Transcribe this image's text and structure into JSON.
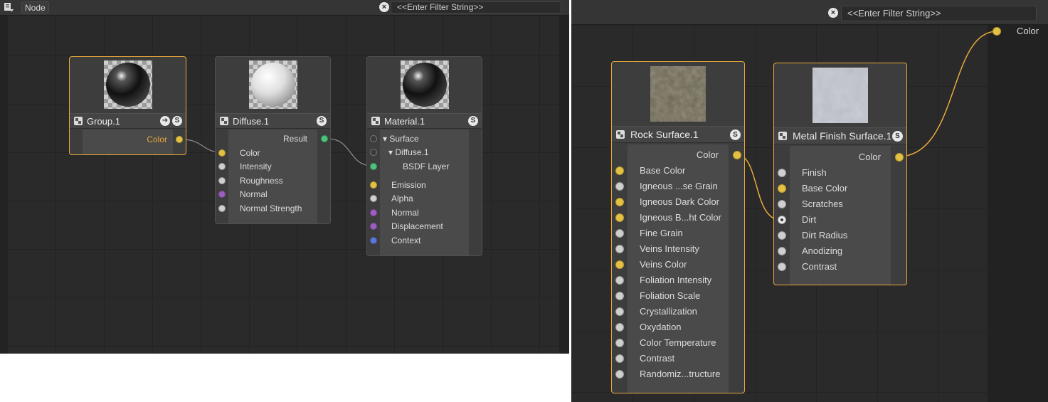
{
  "left_panel": {
    "toolbar": {
      "node_menu": "Node",
      "filter_placeholder": "<<Enter Filter String>>"
    },
    "nodes": {
      "group": {
        "title": "Group.1",
        "output": "Color"
      },
      "diffuse": {
        "title": "Diffuse.1",
        "output": "Result",
        "inputs": [
          "Color",
          "Intensity",
          "Roughness",
          "Normal",
          "Normal Strength"
        ]
      },
      "material": {
        "title": "Material.1",
        "tree": [
          "Surface",
          "Diffuse.1",
          "BSDF Layer"
        ],
        "inputs": [
          "Emission",
          "Alpha",
          "Normal",
          "Displacement",
          "Context"
        ]
      }
    },
    "badge_label": "S"
  },
  "right_panel": {
    "toolbar": {
      "filter_placeholder": "<<Enter Filter String>>"
    },
    "output_column_label": "Color",
    "nodes": {
      "rock": {
        "title": "Rock Surface.1",
        "output": "Color",
        "inputs": [
          "Base Color",
          "Igneous ...se Grain",
          "Igneous Dark Color",
          "Igneous B...ht Color",
          "Fine Grain",
          "Veins Intensity",
          "Veins Color",
          "Foliation Intensity",
          "Foliation Scale",
          "Crystallization",
          "Oxydation",
          "Color Temperature",
          "Contrast",
          "Randomiz...tructure"
        ]
      },
      "metal": {
        "title": "Metal Finish Surface.1",
        "output": "Color",
        "inputs": [
          "Finish",
          "Base Color",
          "Scratches",
          "Dirt",
          "Dirt Radius",
          "Anodizing",
          "Contrast"
        ]
      }
    },
    "badge_label": "S"
  },
  "colors": {
    "selection": "#e7a93b",
    "wire_gray": "#8a8a8a",
    "wire_orange": "#e7a93b"
  }
}
